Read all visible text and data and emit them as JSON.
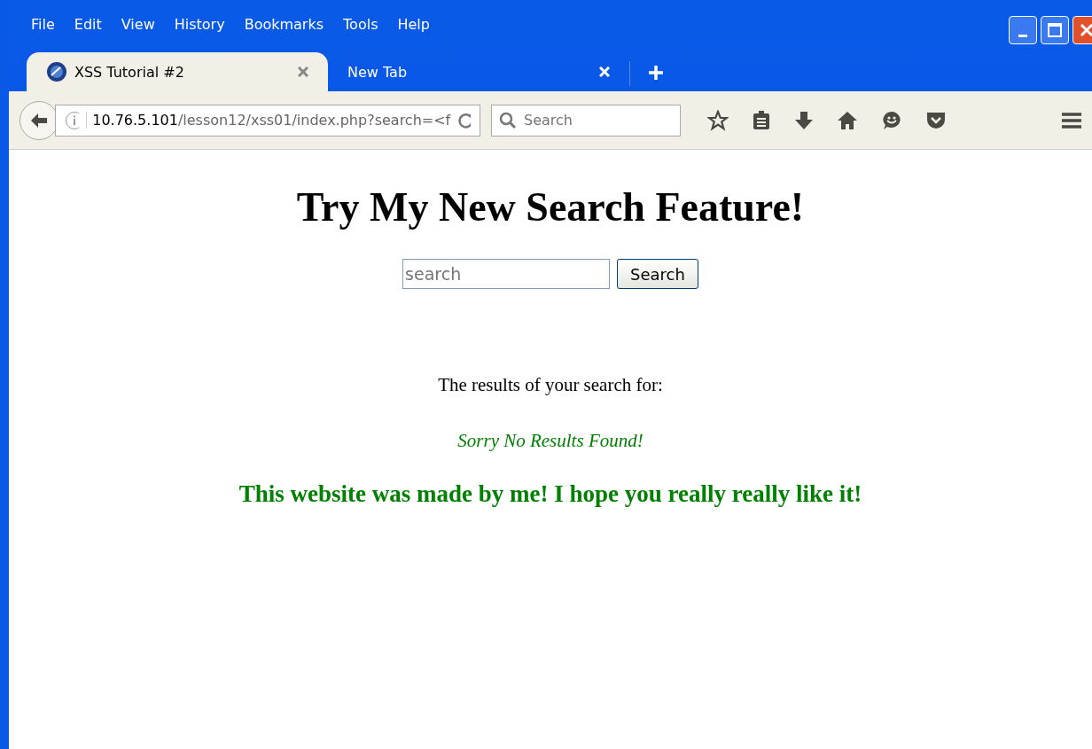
{
  "menu": [
    "File",
    "Edit",
    "View",
    "History",
    "Bookmarks",
    "Tools",
    "Help"
  ],
  "tabs": [
    {
      "title": "XSS Tutorial #2",
      "selected": true
    },
    {
      "title": "New Tab",
      "selected": false
    }
  ],
  "address_bar": {
    "host": "10.76.5.101",
    "path": "/lesson12/xss01/index.php?search=<f"
  },
  "search_box": {
    "placeholder": "Search"
  },
  "page": {
    "heading": "Try My New Search Feature!",
    "search_field": {
      "placeholder": "search"
    },
    "search_button": "Search",
    "results_label": "The results of your search for:",
    "no_results": "Sorry No Results Found!",
    "footer_note": "This website was made by me! I hope you really really like it!"
  }
}
